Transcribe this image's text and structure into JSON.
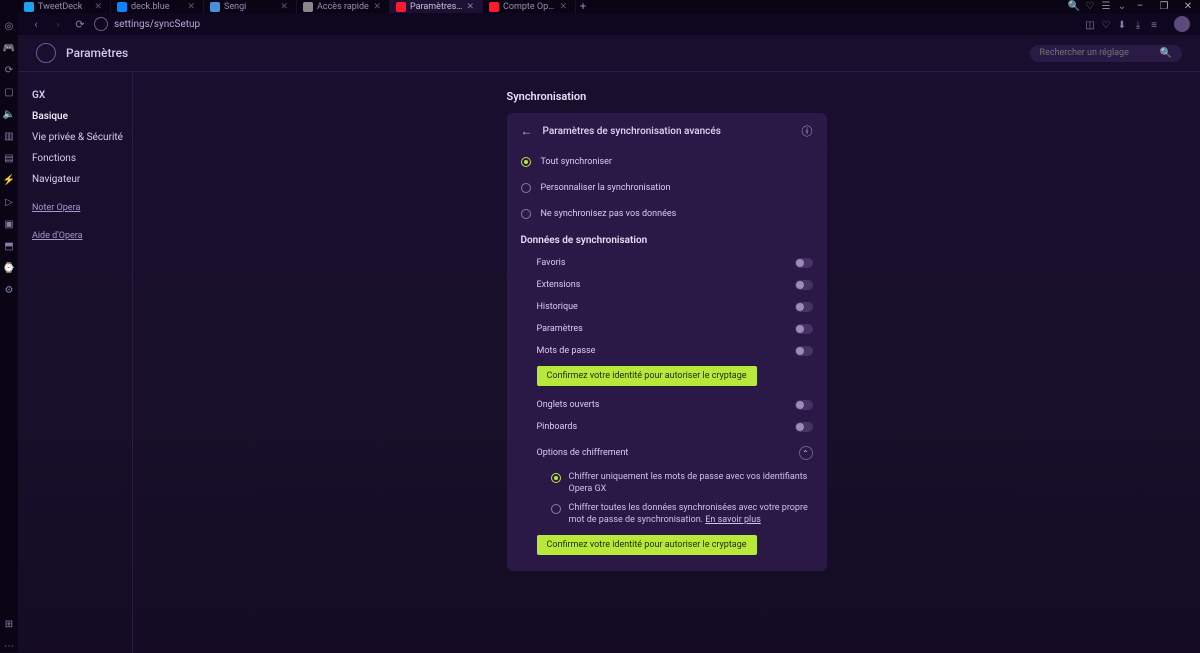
{
  "window": {
    "minimize": "–",
    "maximize": "❐",
    "close": "✕",
    "new_tab": "+"
  },
  "globalicons": [
    "🔍",
    "♡",
    "☰",
    "⌄"
  ],
  "tabs": [
    {
      "label": "TweetDeck",
      "favcolor": "#1da1f2"
    },
    {
      "label": "deck.blue",
      "favcolor": "#0a84ff"
    },
    {
      "label": "Sengi",
      "favcolor": "#4a90d9"
    },
    {
      "label": "Accès rapide",
      "favcolor": "#888888"
    },
    {
      "label": "Paramètres – Paramètres d",
      "favcolor": "#ff1b2d",
      "active": true
    },
    {
      "label": "Compte Opera",
      "favcolor": "#ff1b2d"
    }
  ],
  "addr": {
    "url": "settings/syncSetup",
    "icons": [
      "◫",
      "♡",
      "⬇",
      "⤓",
      "≡"
    ]
  },
  "rail": [
    "◎",
    "🎮",
    "⟳",
    "▢",
    "🔈",
    "▥",
    "▤",
    "⚡",
    "▷",
    "▣",
    "⬒",
    "⌚",
    "⚙"
  ],
  "rail_bottom": [
    "⊞",
    "⋯"
  ],
  "page": {
    "title": "Paramètres",
    "search_placeholder": "Rechercher un réglage"
  },
  "sidebar": {
    "group": "GX",
    "items": [
      {
        "label": "Basique",
        "active": true
      },
      {
        "label": "Vie privée & Sécurité"
      },
      {
        "label": "Fonctions"
      },
      {
        "label": "Navigateur"
      }
    ],
    "links": [
      "Noter Opera",
      "Aide d'Opera"
    ]
  },
  "sync": {
    "title": "Synchronisation",
    "advanced_title": "Paramètres de synchronisation avancés",
    "radios": [
      {
        "label": "Tout synchroniser",
        "selected": true
      },
      {
        "label": "Personnaliser la synchronisation",
        "selected": false
      },
      {
        "label": "Ne synchronisez pas vos données",
        "selected": false
      }
    ],
    "data_title": "Données de synchronisation",
    "toggles": [
      {
        "label": "Favoris"
      },
      {
        "label": "Extensions"
      },
      {
        "label": "Historique"
      },
      {
        "label": "Paramètres"
      },
      {
        "label": "Mots de passe",
        "identity": true
      },
      {
        "label": "Onglets ouverts"
      },
      {
        "label": "Pinboards"
      }
    ],
    "identity_btn": "Confirmez votre identité pour autoriser le cryptage",
    "enc_title": "Options de chiffrement",
    "enc_radios": [
      {
        "label": "Chiffrer uniquement les mots de passe avec vos identifiants Opera GX",
        "selected": true
      },
      {
        "label": "Chiffrer toutes les données synchronisées avec votre propre mot de passe de synchronisation.",
        "learn": "En savoir plus",
        "selected": false
      }
    ]
  }
}
